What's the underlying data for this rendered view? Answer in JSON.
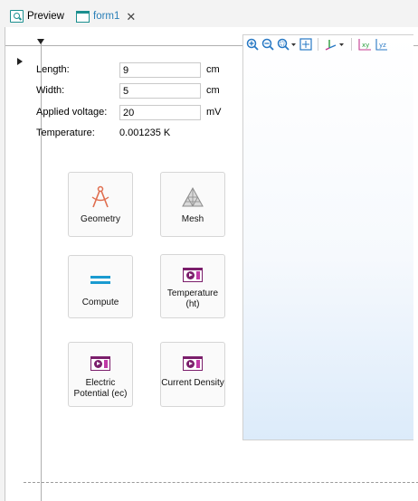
{
  "tabs": [
    {
      "label": "Preview",
      "icon": "preview-icon",
      "active": false
    },
    {
      "label": "form1",
      "icon": "form-icon",
      "active": true,
      "closable": true
    }
  ],
  "tab_close_glyph": "✕",
  "fields": [
    {
      "label": "Length:",
      "value": "9",
      "unit": "cm"
    },
    {
      "label": "Width:",
      "value": "5",
      "unit": "cm"
    },
    {
      "label": "Applied voltage:",
      "value": "20",
      "unit": "mV"
    }
  ],
  "temperature": {
    "label": "Temperature:",
    "value": "0.001235 K"
  },
  "buttons": [
    {
      "label": "Geometry",
      "icon": "geometry-compass-icon"
    },
    {
      "label": "Mesh",
      "icon": "mesh-icon"
    },
    {
      "label": "Compute",
      "icon": "compute-equals-icon"
    },
    {
      "label": "Temperature (ht)",
      "icon": "plot-group-icon"
    },
    {
      "label": "Electric Potential (ec)",
      "icon": "plot-group-icon"
    },
    {
      "label": "Current Density",
      "icon": "plot-group-icon"
    }
  ],
  "graphics_toolbar": [
    "zoom-in-icon",
    "zoom-out-icon",
    "zoom-box-icon",
    "zoom-extents-icon",
    "axis-orientation-icon",
    "xy-view-icon",
    "yz-view-icon"
  ],
  "graphics_toolbar_text": {
    "xy": "xy",
    "yz": "yz"
  },
  "colors": {
    "tab_icon": "#1b8f8f",
    "active_tab_text": "#2a7fb8",
    "geometry_icon": "#e06d4e",
    "compute_icon": "#1a9bd0",
    "plot_icon": "#7b1e6b",
    "toolbar_icon": "#2778c4"
  }
}
